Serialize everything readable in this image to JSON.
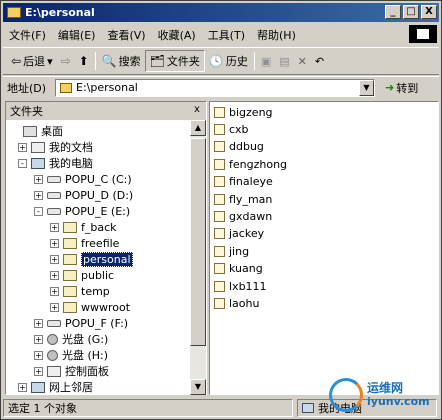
{
  "window": {
    "title": "E:\\personal",
    "min": "_",
    "max": "□",
    "close": "X"
  },
  "menu": [
    "文件(F)",
    "编辑(E)",
    "查看(V)",
    "收藏(A)",
    "工具(T)",
    "帮助(H)"
  ],
  "toolbar": {
    "back": "后退",
    "search": "搜索",
    "folders": "文件夹",
    "history": "历史"
  },
  "address": {
    "label": "地址(D)",
    "value": "E:\\personal",
    "go": "转到"
  },
  "left_pane": {
    "title": "文件夹",
    "close": "x",
    "tree": [
      {
        "label": "桌面",
        "icon": "desktop-icon",
        "expander": ""
      },
      {
        "label": "我的文档",
        "icon": "documents-icon",
        "expander": "+"
      },
      {
        "label": "我的电脑",
        "icon": "computer-icon",
        "expander": "-"
      },
      {
        "label": "POPU_C (C:)",
        "icon": "drive-icon",
        "expander": "+"
      },
      {
        "label": "POPU_D (D:)",
        "icon": "drive-icon",
        "expander": "+"
      },
      {
        "label": "POPU_E (E:)",
        "icon": "drive-icon",
        "expander": "-"
      },
      {
        "label": "f_back",
        "icon": "folder-icon",
        "expander": "+"
      },
      {
        "label": "freefile",
        "icon": "folder-icon",
        "expander": "+"
      },
      {
        "label": "personal",
        "icon": "folder-icon",
        "expander": "+"
      },
      {
        "label": "public",
        "icon": "folder-icon",
        "expander": "+"
      },
      {
        "label": "temp",
        "icon": "folder-icon",
        "expander": "+"
      },
      {
        "label": "wwwroot",
        "icon": "folder-icon",
        "expander": "+"
      },
      {
        "label": "POPU_F (F:)",
        "icon": "drive-icon",
        "expander": "+"
      },
      {
        "label": "光盘 (G:)",
        "icon": "cd-icon",
        "expander": "+"
      },
      {
        "label": "光盘 (H:)",
        "icon": "cd-icon",
        "expander": "+"
      },
      {
        "label": "控制面板",
        "icon": "control-panel-icon",
        "expander": "+"
      },
      {
        "label": "网上邻居",
        "icon": "network-icon",
        "expander": "+"
      }
    ]
  },
  "files": [
    "bigzeng",
    "cxb",
    "ddbug",
    "fengzhong",
    "finaleye",
    "fly_man",
    "gxdawn",
    "jackey",
    "jing",
    "kuang",
    "lxb111",
    "laohu"
  ],
  "status": {
    "left": "选定 1 个对象",
    "right": "我的电脑"
  },
  "watermark": {
    "name": "运维网",
    "url": "iyunv.com"
  }
}
